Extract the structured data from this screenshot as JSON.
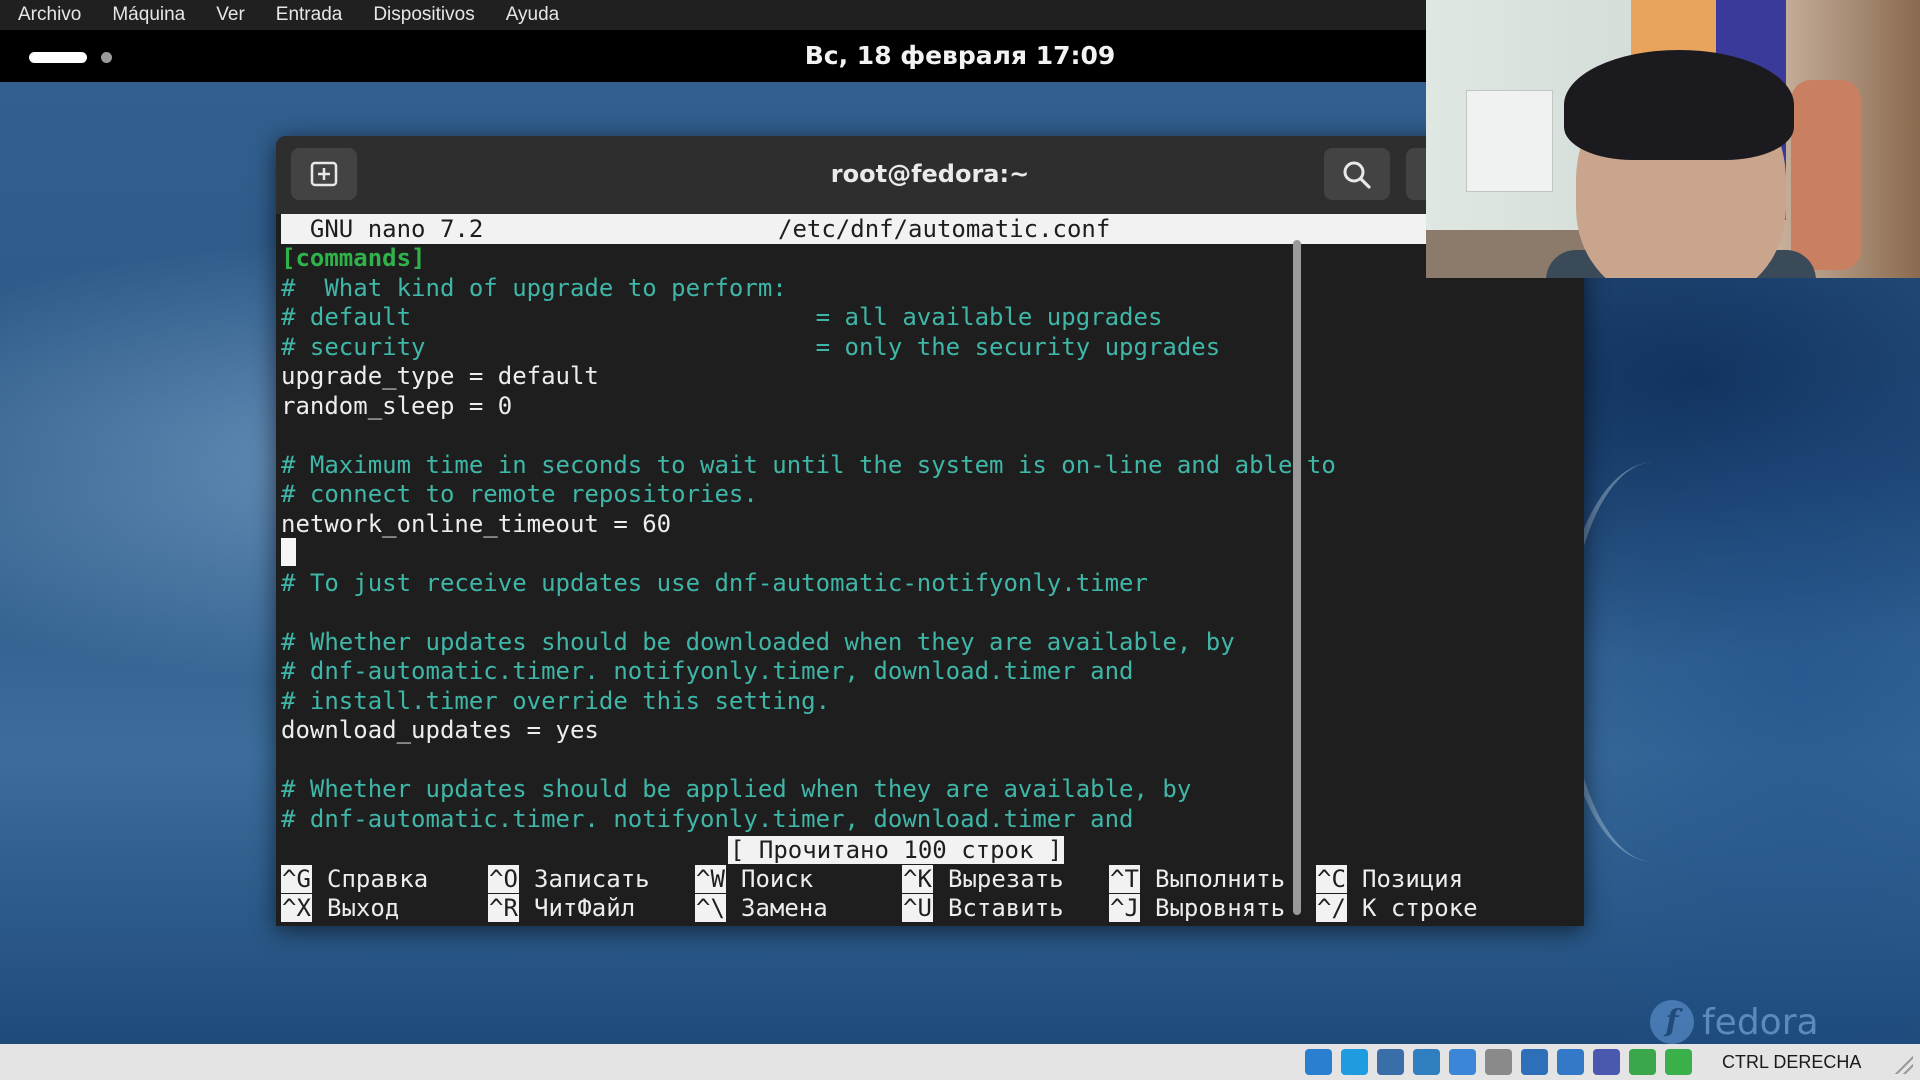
{
  "vbox_menu": {
    "items": [
      "Archivo",
      "Máquina",
      "Ver",
      "Entrada",
      "Dispositivos",
      "Ayuda"
    ]
  },
  "gnome_topbar": {
    "clock": "Вс, 18 февраля  17:09"
  },
  "terminal": {
    "title": "root@fedora:~",
    "new_tab_icon": "new-tab-icon",
    "search_icon": "search-icon"
  },
  "nano": {
    "header_version": "  GNU nano 7.2",
    "header_file": "/etc/dnf/automatic.conf",
    "lines": [
      {
        "text": "[commands]",
        "style": "section"
      },
      {
        "text": "#  What kind of upgrade to perform:",
        "style": "comment"
      },
      {
        "text": "# default                            = all available upgrades",
        "style": "comment"
      },
      {
        "text": "# security                           = only the security upgrades",
        "style": "comment"
      },
      {
        "text": "upgrade_type = default",
        "style": "plain"
      },
      {
        "text": "random_sleep = 0",
        "style": "plain"
      },
      {
        "text": "",
        "style": "plain"
      },
      {
        "text": "# Maximum time in seconds to wait until the system is on-line and able to",
        "style": "comment"
      },
      {
        "text": "# connect to remote repositories.",
        "style": "comment"
      },
      {
        "text": "network_online_timeout = 60",
        "style": "plain"
      },
      {
        "text": "",
        "style": "plain"
      },
      {
        "text": "# To just receive updates use dnf-automatic-notifyonly.timer",
        "style": "comment"
      },
      {
        "text": "",
        "style": "plain"
      },
      {
        "text": "# Whether updates should be downloaded when they are available, by",
        "style": "comment"
      },
      {
        "text": "# dnf-automatic.timer. notifyonly.timer, download.timer and",
        "style": "comment"
      },
      {
        "text": "# install.timer override this setting.",
        "style": "comment"
      },
      {
        "text": "download_updates = yes",
        "style": "plain"
      },
      {
        "text": "",
        "style": "plain"
      },
      {
        "text": "# Whether updates should be applied when they are available, by",
        "style": "comment"
      },
      {
        "text": "# dnf-automatic.timer. notifyonly.timer, download.timer and",
        "style": "comment"
      }
    ],
    "status_message": "[ Прочитано 100 строк ]",
    "shortcuts": [
      {
        "key": "^G",
        "label": "Справка"
      },
      {
        "key": "^O",
        "label": "Записать"
      },
      {
        "key": "^W",
        "label": "Поиск"
      },
      {
        "key": "^K",
        "label": "Вырезать"
      },
      {
        "key": "^T",
        "label": "Выполнить"
      },
      {
        "key": "^C",
        "label": "Позиция"
      },
      {
        "key": "^X",
        "label": "Выход"
      },
      {
        "key": "^R",
        "label": "ЧитФайл"
      },
      {
        "key": "^\\",
        "label": "Замена"
      },
      {
        "key": "^U",
        "label": "Вставить"
      },
      {
        "key": "^J",
        "label": "Выровнять"
      },
      {
        "key": "^/",
        "label": "К строке"
      }
    ]
  },
  "desktop": {
    "watermark": "fedora"
  },
  "vbox_statusbar": {
    "icons": [
      "hard-disk-icon",
      "optical-drive-icon",
      "audio-icon",
      "network-icon",
      "usb-icon",
      "shared-folders-icon",
      "display-icon",
      "recording-icon",
      "cpu-icon",
      "mouse-integration-icon",
      "keyboard-icon"
    ],
    "host_key": "CTRL DERECHA"
  },
  "colors": {
    "nano_comment": "#3fb6a7",
    "nano_section": "#2fb24a",
    "terminal_bg": "#1e1e1e",
    "header_bg": "#2e2e2e"
  }
}
